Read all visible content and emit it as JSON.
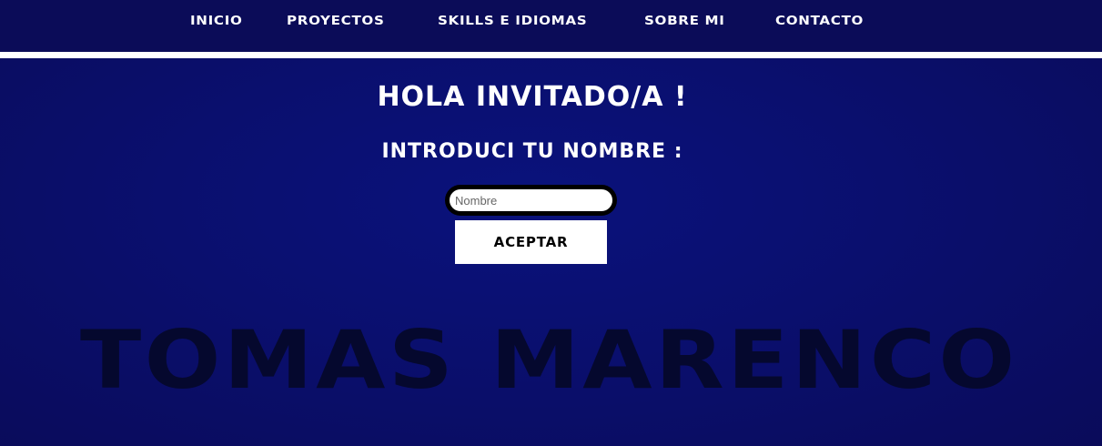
{
  "nav": {
    "items": [
      {
        "label": "INICIO"
      },
      {
        "label": "PROYECTOS"
      },
      {
        "label": "SKILLS E IDIOMAS"
      },
      {
        "label": "SOBRE MI"
      },
      {
        "label": "CONTACTO"
      }
    ]
  },
  "main": {
    "greeting": "HOLA INVITADO/A !",
    "prompt": "INTRODUCI TU NOMBRE :",
    "name_input": {
      "value": "",
      "placeholder": "Nombre"
    },
    "accept_label": "ACEPTAR",
    "hero_name": "TOMAS MARENCO"
  },
  "colors": {
    "background": "#0a0f6e",
    "navbar": "#0b0c58",
    "text": "#ffffff",
    "hero_name": "#05082e",
    "button": "#ffffff"
  }
}
